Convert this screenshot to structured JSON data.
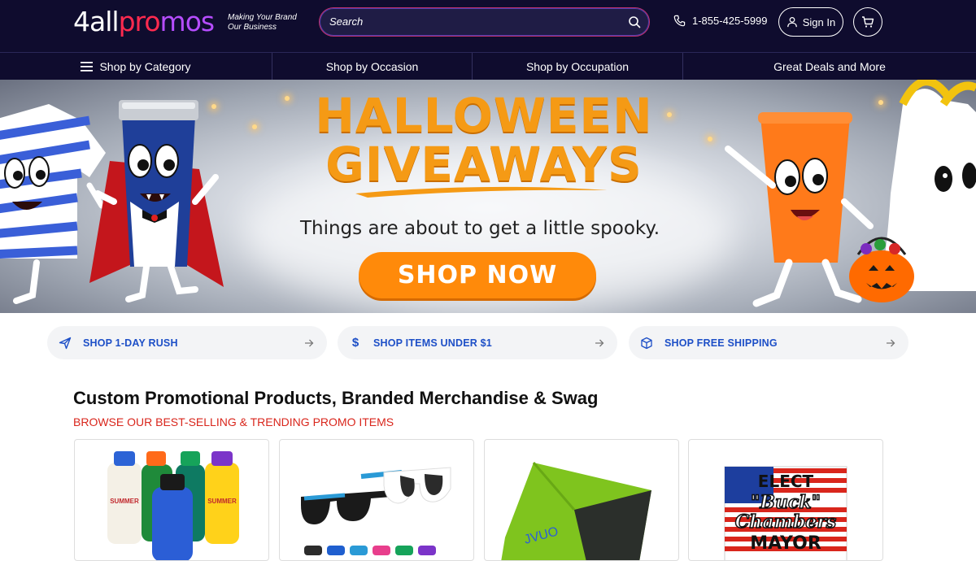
{
  "header": {
    "logo": {
      "part1": "4all",
      "part2": "pro",
      "part3": "mos"
    },
    "tagline_line1": "Making Your Brand",
    "tagline_line2": "Our Business",
    "search_placeholder": "Search",
    "phone": "1-855-425-5999",
    "signin_label": "Sign In"
  },
  "nav": {
    "items": [
      {
        "label": "Shop by Category"
      },
      {
        "label": "Shop by Occasion"
      },
      {
        "label": "Shop by Occupation"
      },
      {
        "label": "Great Deals and More"
      }
    ]
  },
  "banner": {
    "headline1": "HALLOWEEN",
    "headline2": "GIVEAWAYS",
    "subline": "Things are about to get a little spooky.",
    "cta": "SHOP NOW"
  },
  "quick_links": [
    {
      "label": "SHOP 1-DAY RUSH",
      "icon": "paper-plane-icon"
    },
    {
      "label": "SHOP ITEMS UNDER $1",
      "icon": "dollar-icon"
    },
    {
      "label": "SHOP FREE SHIPPING",
      "icon": "box-icon"
    }
  ],
  "section": {
    "title": "Custom Promotional Products, Branded Merchandise & Swag",
    "subtitle": "BROWSE OUR BEST-SELLING & TRENDING PROMO ITEMS"
  },
  "products": {
    "bottle_text": "SUMMER",
    "towel_text": "JVUO",
    "sign_line1": "ELECT",
    "sign_line2": "\"Buck\"",
    "sign_line3": "Chambers",
    "sign_line4": "MAYOR"
  },
  "colors": {
    "header_bg": "#0f0c2e",
    "accent_orange": "#ff8a0a",
    "link_blue": "#1d4fc7",
    "subtitle_red": "#d9261c"
  }
}
